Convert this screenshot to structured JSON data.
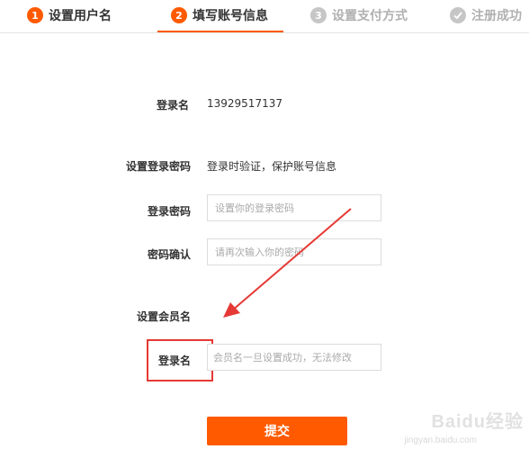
{
  "steps": [
    {
      "number": "1",
      "label": "设置用户名"
    },
    {
      "number": "2",
      "label": "填写账号信息"
    },
    {
      "number": "3",
      "label": "设置支付方式"
    },
    {
      "label": "注册成功"
    }
  ],
  "colors": {
    "accent": "#ff5a00",
    "highlight_box": "#e53935",
    "arrow": "#e53935"
  },
  "form": {
    "login_name_label": "登录名",
    "login_name_value": "13929517137",
    "set_password_label": "设置登录密码",
    "set_password_hint": "登录时验证，保护账号信息",
    "password_label": "登录密码",
    "password_placeholder": "设置你的登录密码",
    "confirm_label": "密码确认",
    "confirm_placeholder": "请再次输入你的密码",
    "member_section_label": "设置会员名",
    "member_login_label": "登录名",
    "member_placeholder": "会员名一旦设置成功，无法修改",
    "submit_label": "提交"
  },
  "watermark": {
    "text": "Baidu经验",
    "sub": "jingyan.baidu.com"
  }
}
